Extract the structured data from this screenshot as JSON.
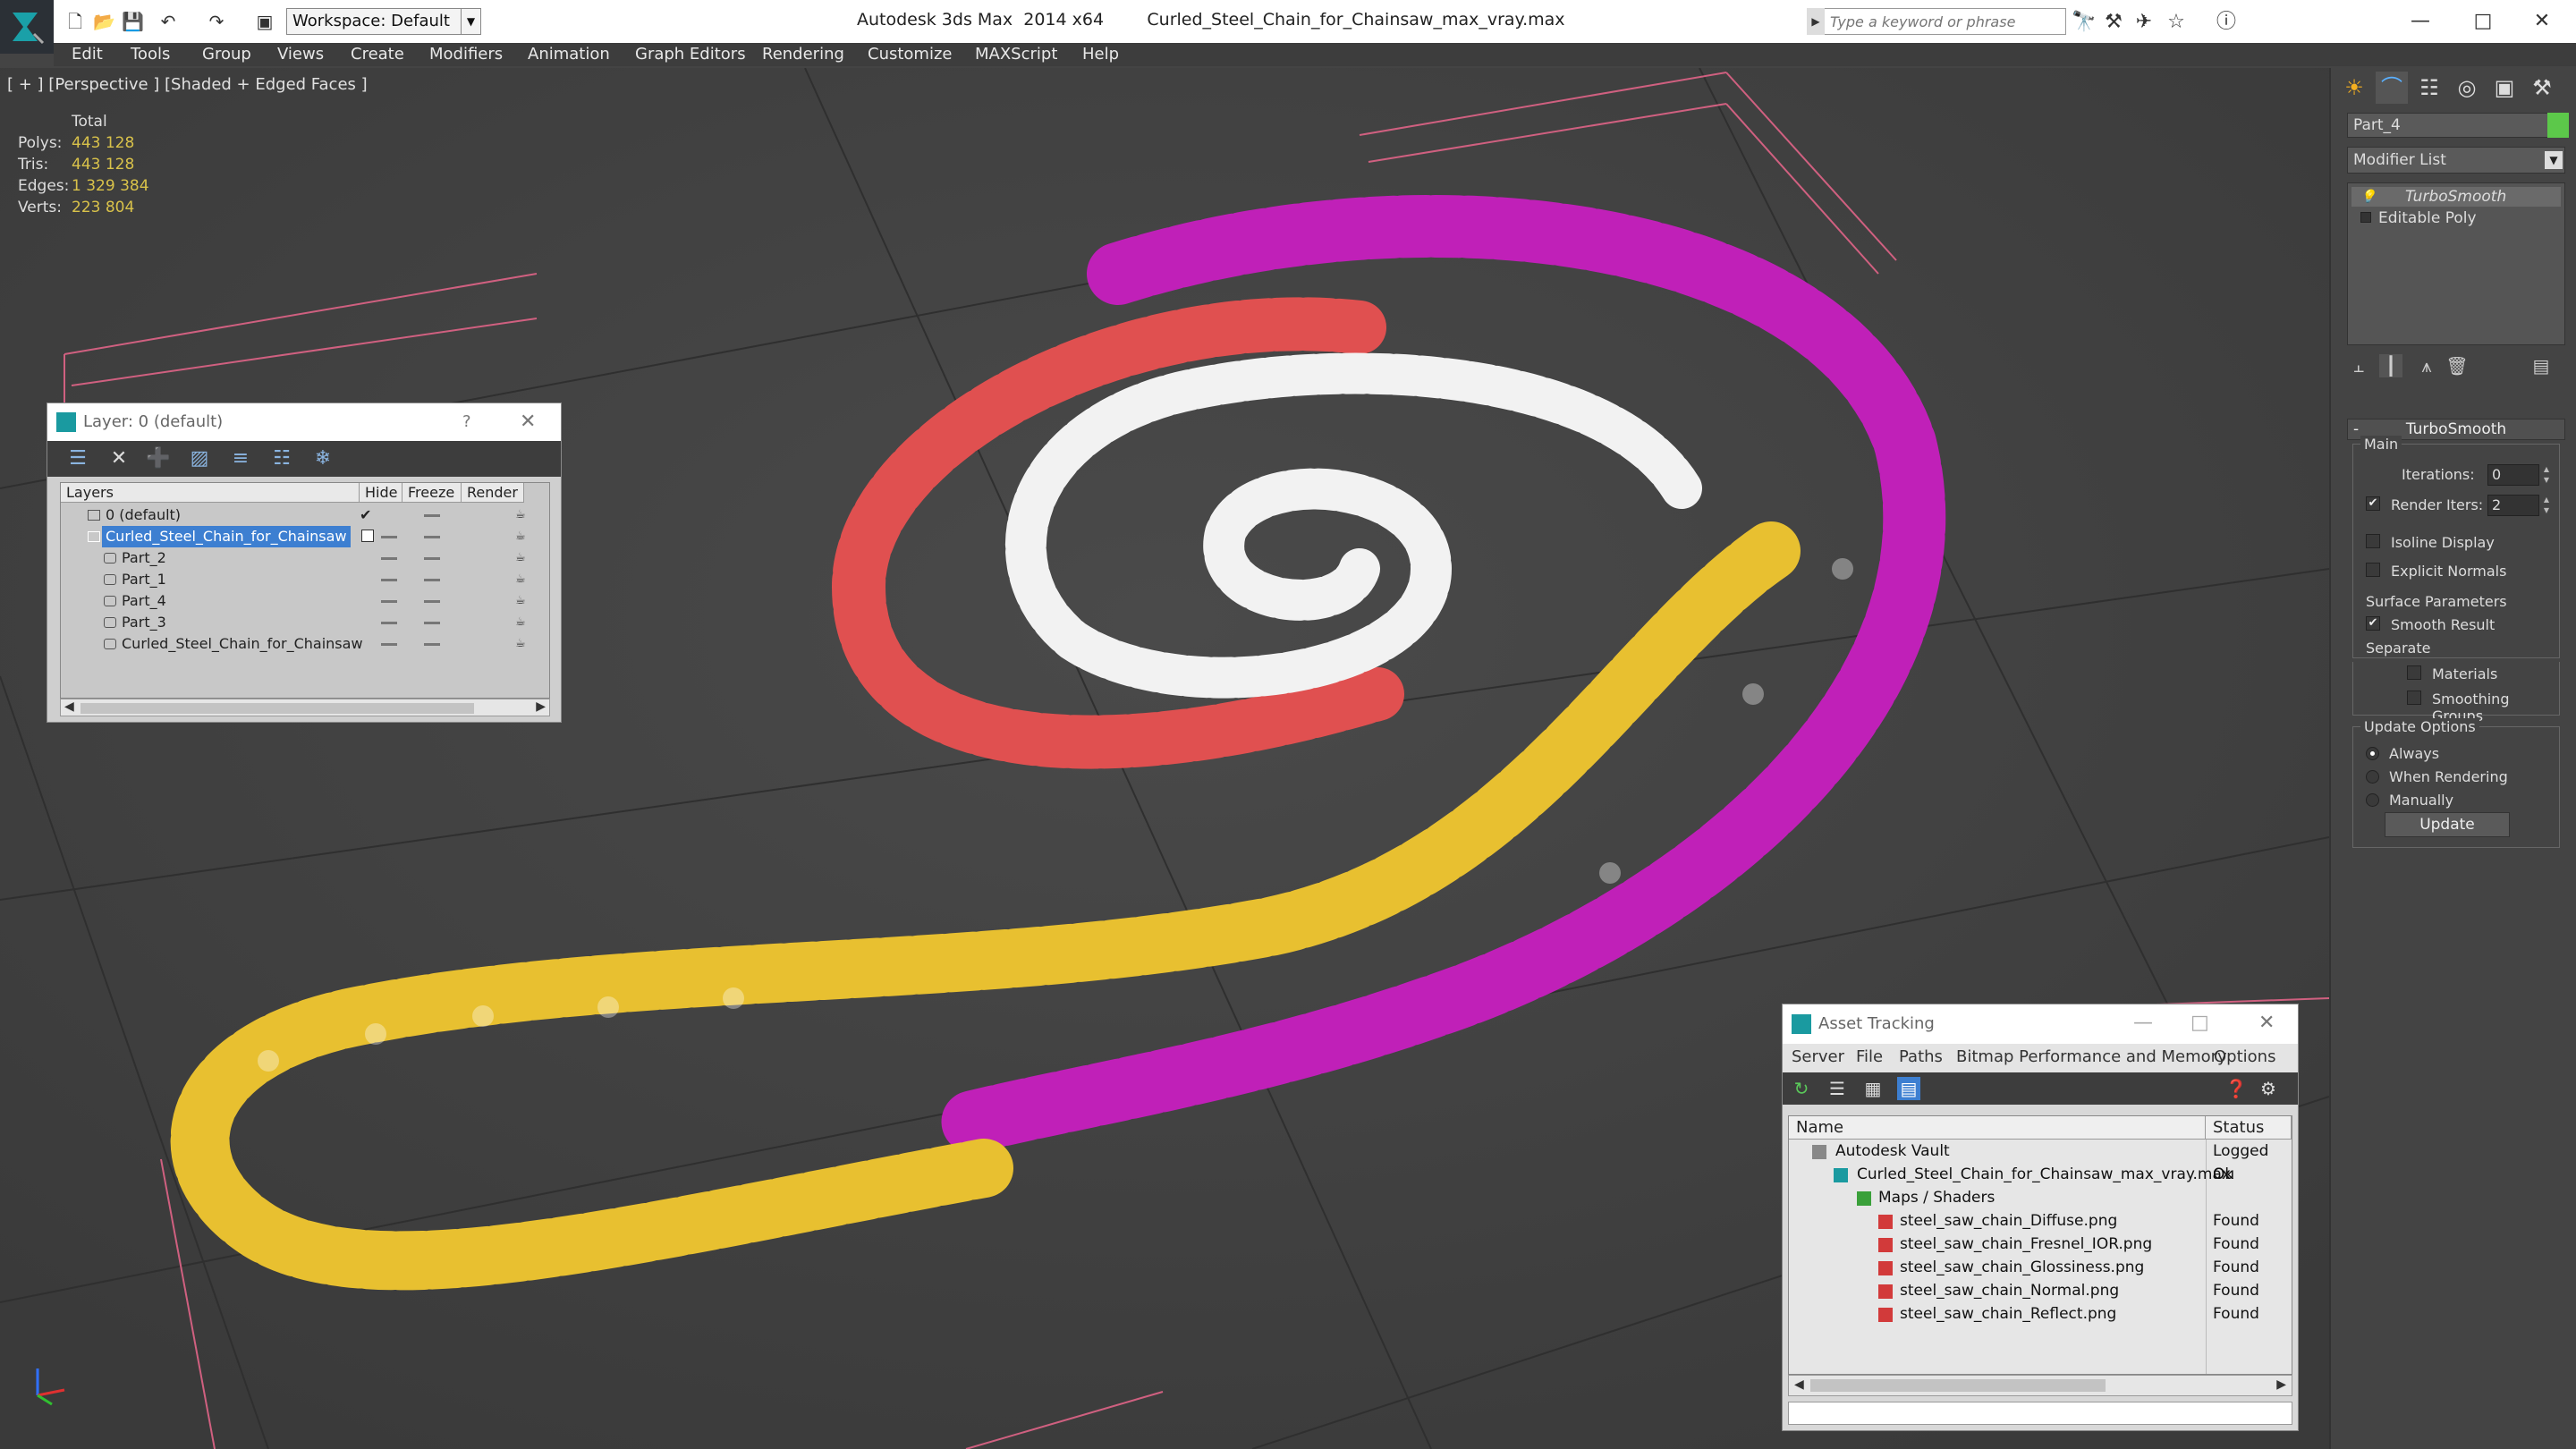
{
  "app": {
    "title": "Autodesk 3ds Max  2014 x64        Curled_Steel_Chain_for_Chainsaw_max_vray.max",
    "workspace": "Workspace: Default",
    "search_placeholder": "Type a keyword or phrase"
  },
  "menu": [
    "Edit",
    "Tools",
    "Group",
    "Views",
    "Create",
    "Modifiers",
    "Animation",
    "Graph Editors",
    "Rendering",
    "Customize",
    "MAXScript",
    "Help"
  ],
  "viewport": {
    "label": "[ + ] [Perspective ] [Shaded + Edged Faces ]",
    "stats_header": "Total",
    "stats": [
      {
        "label": "Polys:",
        "value": "443 128"
      },
      {
        "label": "Tris:",
        "value": "443 128"
      },
      {
        "label": "Edges:",
        "value": "1 329 384"
      },
      {
        "label": "Verts:",
        "value": "223 804"
      }
    ],
    "colors": {
      "magenta": "#c020b8",
      "red": "#e05050",
      "white": "#f2f2f2",
      "yellow": "#e8c030"
    }
  },
  "layer_dialog": {
    "title": "Layer: 0 (default)",
    "help": "?",
    "columns": [
      "Layers",
      "Hide",
      "Freeze",
      "Render"
    ],
    "rows": [
      {
        "name": "0 (default)",
        "level": 0,
        "selected": false
      },
      {
        "name": "Curled_Steel_Chain_for_Chainsaw",
        "level": 0,
        "selected": true
      },
      {
        "name": "Part_2",
        "level": 1,
        "selected": false
      },
      {
        "name": "Part_1",
        "level": 1,
        "selected": false
      },
      {
        "name": "Part_4",
        "level": 1,
        "selected": false
      },
      {
        "name": "Part_3",
        "level": 1,
        "selected": false
      },
      {
        "name": "Curled_Steel_Chain_for_Chainsaw",
        "level": 1,
        "selected": false
      }
    ]
  },
  "asset_dialog": {
    "title": "Asset Tracking",
    "menu": [
      "Server",
      "File",
      "Paths",
      "Bitmap Performance and Memory",
      "Options"
    ],
    "columns": [
      "Name",
      "Status"
    ],
    "rows": [
      {
        "name": "Autodesk Vault",
        "status": "Logged Ou",
        "level": 0
      },
      {
        "name": "Curled_Steel_Chain_for_Chainsaw_max_vray.max",
        "status": "Ok",
        "level": 1
      },
      {
        "name": "Maps / Shaders",
        "status": "",
        "level": 2
      },
      {
        "name": "steel_saw_chain_Diffuse.png",
        "status": "Found",
        "level": 3
      },
      {
        "name": "steel_saw_chain_Fresnel_IOR.png",
        "status": "Found",
        "level": 3
      },
      {
        "name": "steel_saw_chain_Glossiness.png",
        "status": "Found",
        "level": 3
      },
      {
        "name": "steel_saw_chain_Normal.png",
        "status": "Found",
        "level": 3
      },
      {
        "name": "steel_saw_chain_Reflect.png",
        "status": "Found",
        "level": 3
      }
    ]
  },
  "command_panel": {
    "object_name": "Part_4",
    "object_color": "#5cc84a",
    "modifier_list": "Modifier List",
    "stack": [
      "TurboSmooth",
      "Editable Poly"
    ],
    "rollout_title": "TurboSmooth",
    "main_group": "Main",
    "iterations_label": "Iterations:",
    "iterations": "0",
    "render_iters_label": "Render Iters:",
    "render_iters": "2",
    "isoline": "Isoline Display",
    "explicit_normals": "Explicit Normals",
    "surface_group": "Surface Parameters",
    "smooth_result": "Smooth Result",
    "separate": "Separate",
    "materials": "Materials",
    "smoothing_groups": "Smoothing Groups",
    "update_group": "Update Options",
    "always": "Always",
    "when_rendering": "When Rendering",
    "manually": "Manually",
    "update_btn": "Update"
  }
}
